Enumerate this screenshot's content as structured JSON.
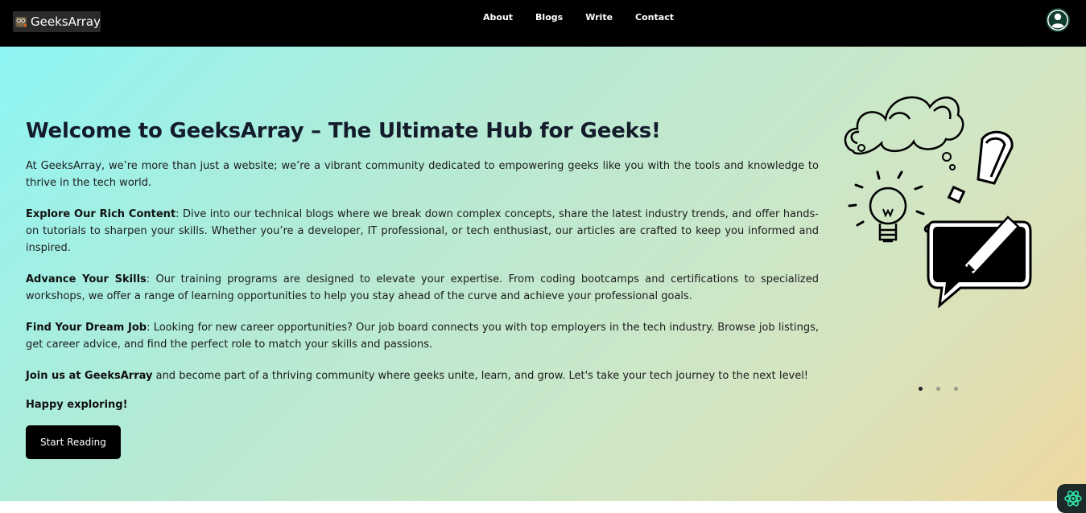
{
  "brand": {
    "name": "GeeksArray"
  },
  "nav": {
    "items": [
      "About",
      "Blogs",
      "Write",
      "Contact"
    ]
  },
  "hero": {
    "title": "Welcome to GeeksArray – The Ultimate Hub for Geeks!",
    "intro": "At GeeksArray, we’re more than just a website; we’re a vibrant community dedicated to empowering geeks like you with the tools and knowledge to thrive in the tech world.",
    "sections": [
      {
        "label": "Explore Our Rich Content",
        "text": ": Dive into our technical blogs where we break down complex concepts, share the latest industry trends, and offer hands-on tutorials to sharpen your skills. Whether you’re a developer, IT professional, or tech enthusiast, our articles are crafted to keep you informed and inspired."
      },
      {
        "label": "Advance Your Skills",
        "text": ": Our training programs are designed to elevate your expertise. From coding bootcamps and certifications to specialized workshops, we offer a range of learning opportunities to help you stay ahead of the curve and achieve your professional goals."
      },
      {
        "label": "Find Your Dream Job",
        "text": ": Looking for new career opportunities? Our job board connects you with top employers in the tech industry. Browse job listings, get career advice, and find the perfect role to match your skills and passions."
      }
    ],
    "join": {
      "label": "Join us at GeeksArray",
      "text": " and become part of a thriving community where geeks unite, learn, and grow. Let's take your tech journey to the next level!"
    },
    "closing": "Happy exploring!",
    "cta_label": "Start Reading"
  },
  "carousel": {
    "slide_count": 3,
    "active_index": 0
  },
  "icons": {
    "user": "user-circle-icon",
    "logo": "owl-logo-icon",
    "assistant": "atom-icon",
    "illustration": "ideas-illustration"
  },
  "colors": {
    "navbar": "#000000",
    "gradient_start": "#8ff5f3",
    "gradient_end": "#eed8a1",
    "button": "#000000",
    "accent": "#2ee6a8"
  }
}
